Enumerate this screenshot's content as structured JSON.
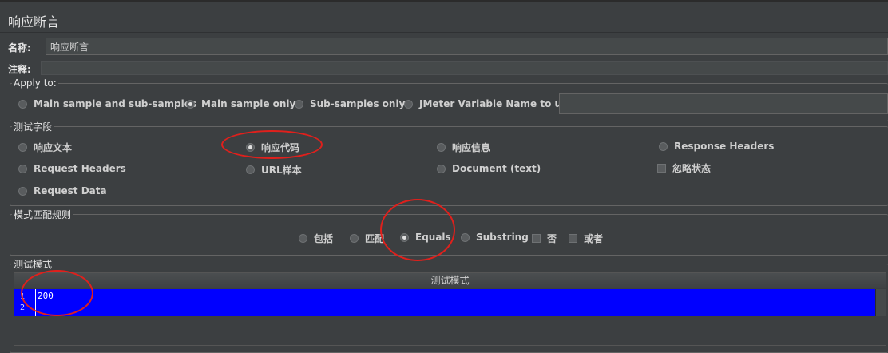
{
  "page": {
    "title": "响应断言"
  },
  "name_field": {
    "label": "名称:",
    "value": "响应断言"
  },
  "comment_field": {
    "label": "注释:",
    "value": ""
  },
  "apply_to": {
    "legend": "Apply to:",
    "options": [
      {
        "label": "Main sample and sub-samples",
        "checked": false
      },
      {
        "label": "Main sample only",
        "checked": true
      },
      {
        "label": "Sub-samples only",
        "checked": false
      },
      {
        "label": "JMeter Variable Name to use",
        "checked": false
      }
    ]
  },
  "test_field": {
    "legend": "测试字段",
    "options": [
      {
        "label": "响应文本",
        "checked": false
      },
      {
        "label": "响应代码",
        "checked": true
      },
      {
        "label": "响应信息",
        "checked": false
      },
      {
        "label": "Response Headers",
        "checked": false
      },
      {
        "label": "Request Headers",
        "checked": false
      },
      {
        "label": "URL样本",
        "checked": false
      },
      {
        "label": "Document (text)",
        "checked": false
      },
      {
        "label": "Request Data",
        "checked": false
      }
    ],
    "ignore_status": {
      "label": "忽略状态",
      "checked": false
    }
  },
  "pattern_rules": {
    "legend": "模式匹配规则",
    "options": [
      {
        "label": "包括",
        "checked": false
      },
      {
        "label": "匹配",
        "checked": false
      },
      {
        "label": "Equals",
        "checked": true
      },
      {
        "label": "Substring",
        "checked": false
      }
    ],
    "not": {
      "label": "否",
      "checked": false
    },
    "or": {
      "label": "或者",
      "checked": false
    }
  },
  "test_patterns": {
    "legend": "测试模式",
    "column_header": "测试模式",
    "lines": [
      "200",
      ""
    ],
    "line_numbers": [
      "1",
      "2"
    ]
  },
  "colors": {
    "background": "#3c3f41",
    "selection": "#0000ff",
    "annotation": "#e0201c"
  }
}
